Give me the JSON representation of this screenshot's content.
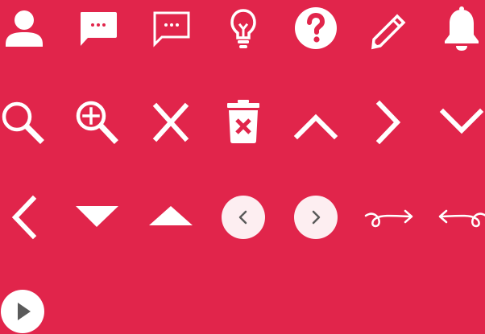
{
  "colors": {
    "background": "#e1254b",
    "icon": "#ffffff",
    "button_fill": "#fdeef1",
    "button_glyph": "#5a5a5a",
    "hole": "#e1254b"
  },
  "icons": [
    "user-icon",
    "chat-bubble-filled-icon",
    "chat-bubble-outline-icon",
    "lightbulb-icon",
    "help-circle-icon",
    "pencil-icon",
    "bell-icon",
    "search-icon",
    "zoom-in-icon",
    "close-icon",
    "trash-icon",
    "chevron-up-icon",
    "chevron-right-icon",
    "chevron-down-icon",
    "chevron-left-icon",
    "caret-down-icon",
    "caret-up-icon",
    "previous-button-icon",
    "next-button-icon",
    "curly-arrow-right-icon",
    "curly-arrow-left-icon",
    "play-circle-icon"
  ]
}
